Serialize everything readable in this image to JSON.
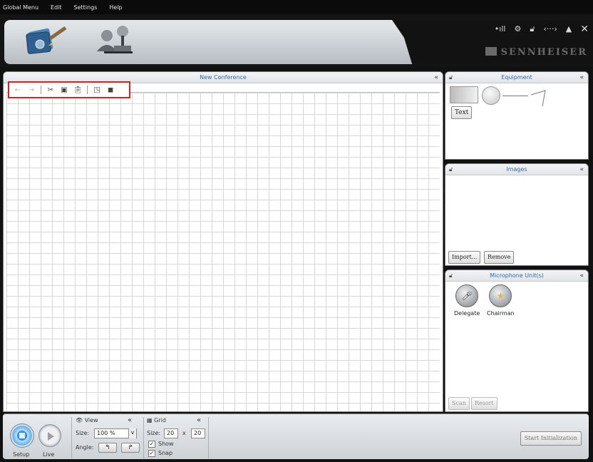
{
  "menu": [
    "Global Menu",
    "Edit",
    "Settings",
    "Help"
  ],
  "header": {
    "status_icons": [
      "signal-icon",
      "devices-icon",
      "lock-open-icon",
      "connection-icon",
      "eject-icon",
      "close-icon"
    ],
    "brand": "SENNHEISER"
  },
  "conference": {
    "title": "New Conference",
    "toolbar": [
      "undo-icon",
      "redo-icon",
      "cut-icon",
      "copy-icon",
      "paste-icon",
      "bring-forward-icon",
      "send-backward-icon"
    ]
  },
  "equipment": {
    "title": "Equipment",
    "text_item": "Text"
  },
  "images": {
    "title": "Images",
    "import_label": "Import...",
    "remove_label": "Remove"
  },
  "microphones": {
    "title": "Microphone Unit(s)",
    "units": [
      "Delegate",
      "Chairman"
    ],
    "scan_label": "Scan",
    "resort_label": "Resort"
  },
  "bottom": {
    "setup_label": "Setup",
    "live_label": "Live",
    "view": {
      "title": "View",
      "size_label": "Size:",
      "size_value": "100 %",
      "angle_label": "Angle:"
    },
    "grid": {
      "title": "Grid",
      "size_label": "Size:",
      "width": "20",
      "x": "x",
      "height": "20",
      "show_label": "Show",
      "snap_label": "Snap"
    },
    "start_label": "Start Initialization"
  }
}
